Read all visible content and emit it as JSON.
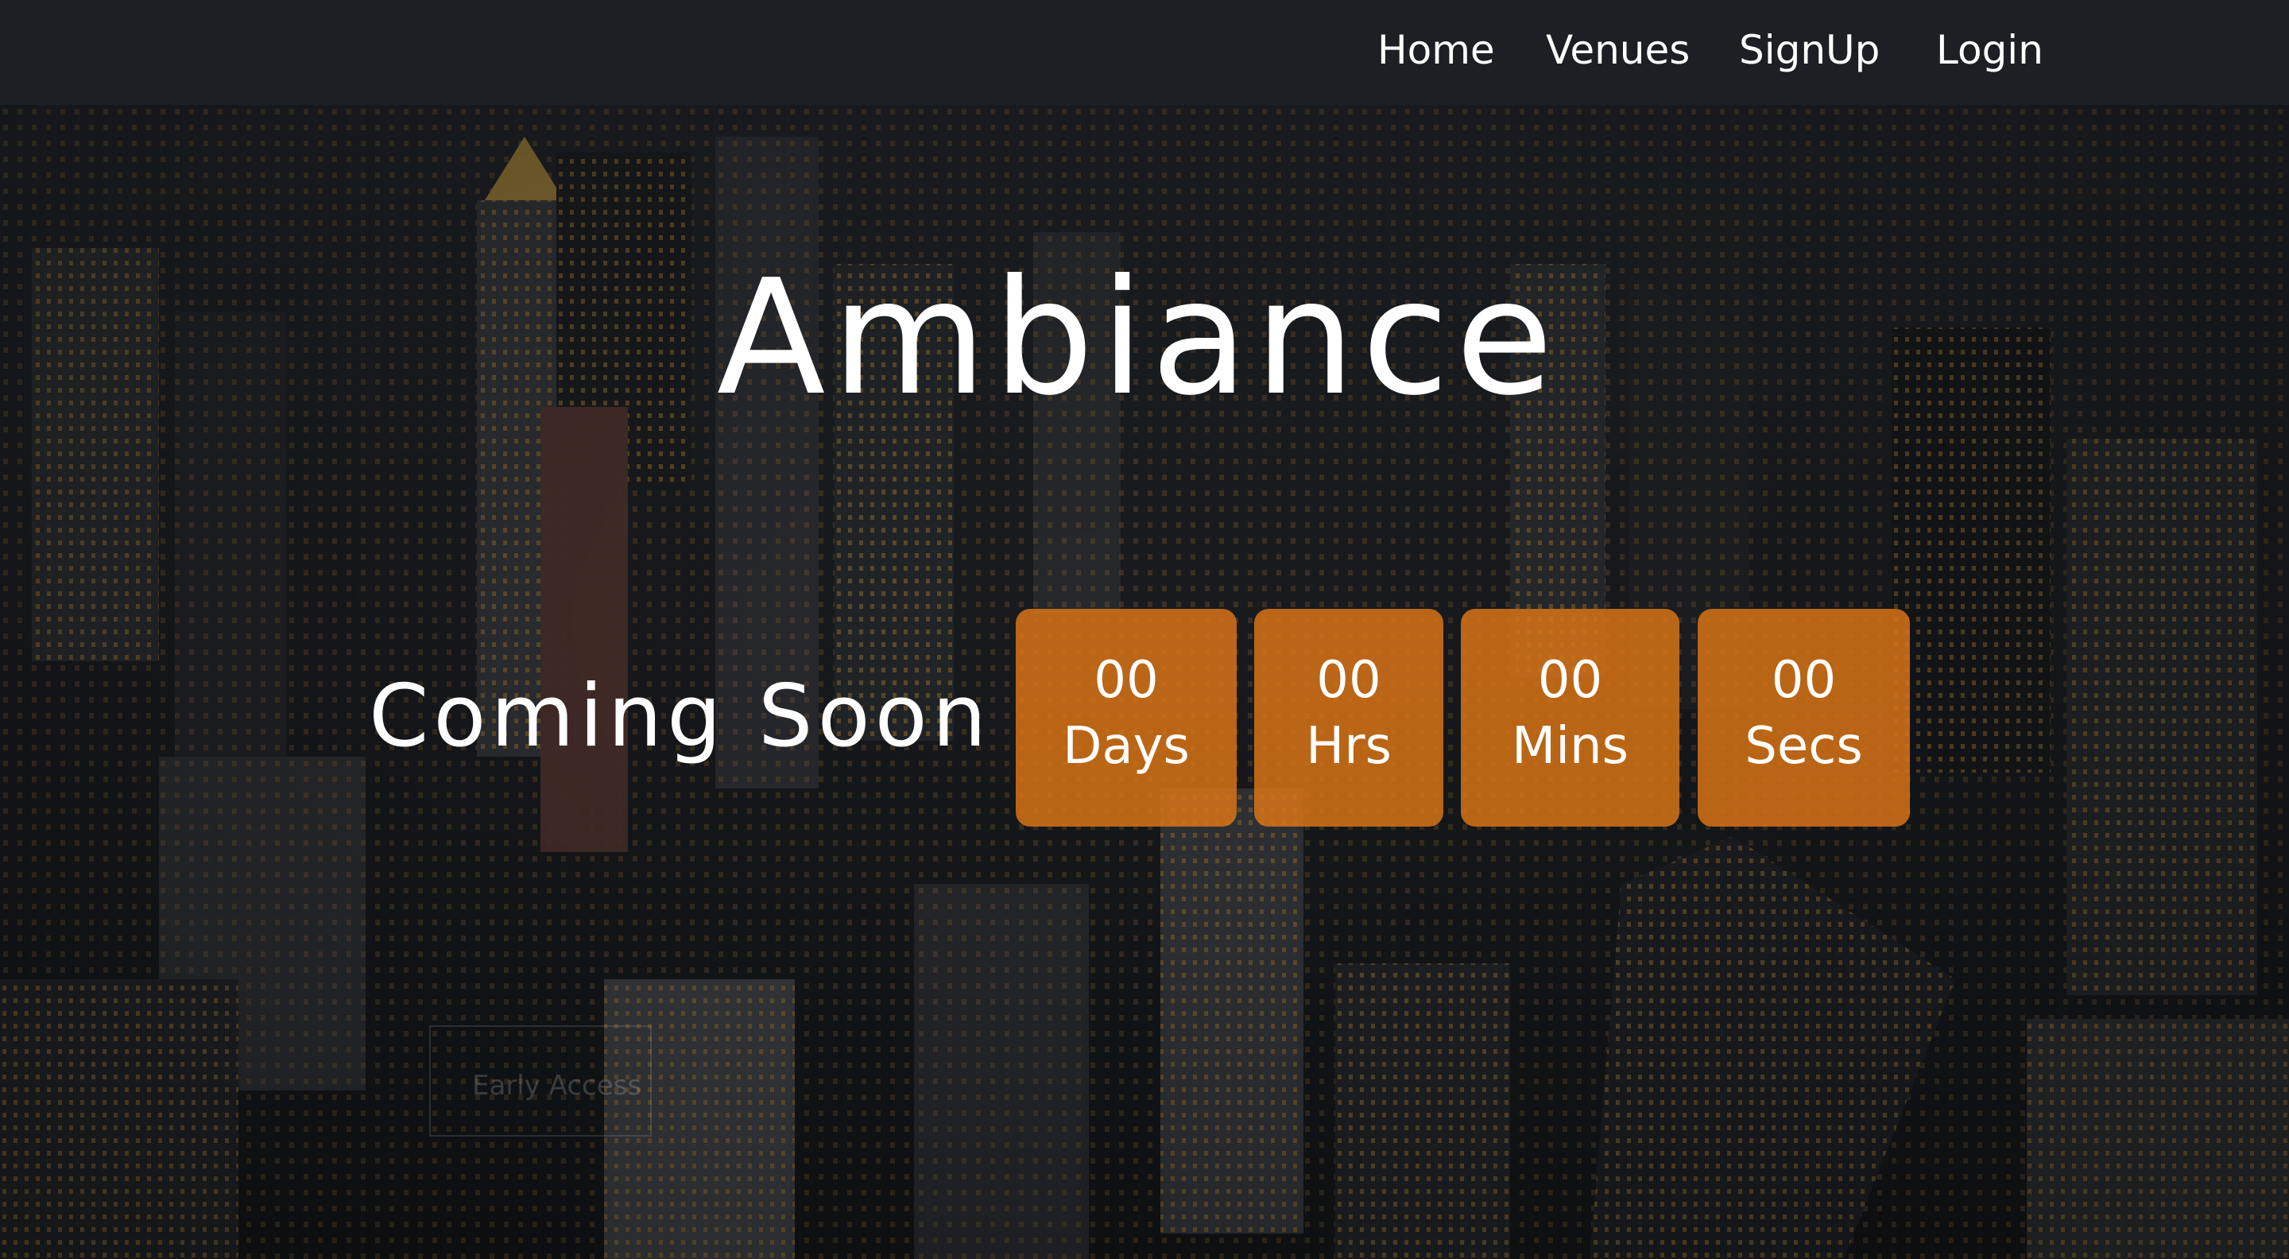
{
  "nav": {
    "home": "Home",
    "venues": "Venues",
    "signup": "SignUp",
    "login": "Login"
  },
  "hero": {
    "title": "Ambiance",
    "subtitle": "Coming Soon",
    "countdown": [
      {
        "value": "00",
        "unit": "Days"
      },
      {
        "value": "00",
        "unit": "Hrs"
      },
      {
        "value": "00",
        "unit": "Mins"
      },
      {
        "value": "00",
        "unit": "Secs"
      }
    ],
    "faded_button": "Early Access"
  },
  "colors": {
    "navbar_bg": "#1c1f23",
    "accent_orange": "#de7616",
    "text": "#ffffff"
  }
}
